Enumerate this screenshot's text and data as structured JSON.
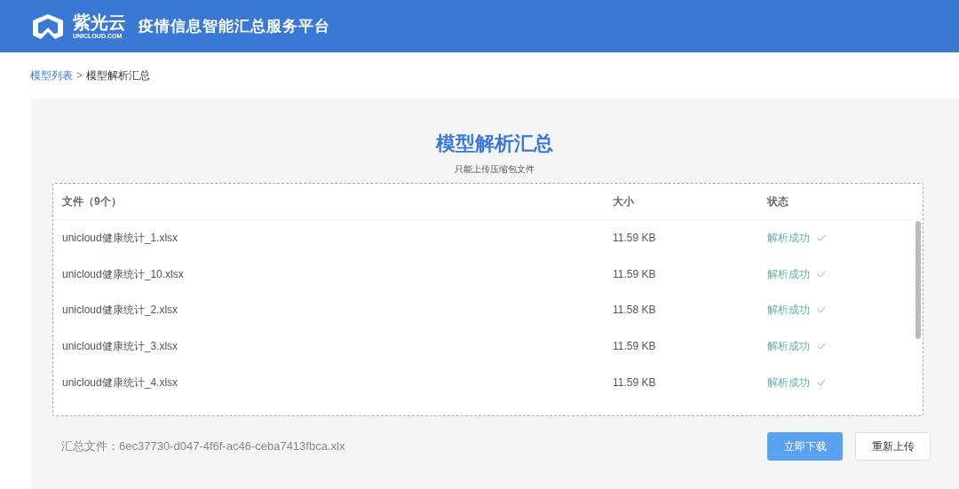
{
  "header": {
    "logo_text": "紫光云",
    "logo_subtext": "UNICLOUD.COM",
    "title": "疫情信息智能汇总服务平台"
  },
  "breadcrumb": [
    {
      "label": "模型列表",
      "link": true
    },
    {
      "label": "模型解析汇总",
      "link": false
    }
  ],
  "breadcrumb_separator": ">",
  "panel": {
    "title": "模型解析汇总",
    "subtitle": "只能上传压缩包文件"
  },
  "table": {
    "columns": [
      "文件（9个）",
      "大小",
      "状态"
    ],
    "rows": [
      {
        "file": "unicloud健康统计_1.xlsx",
        "size": "11.59 KB",
        "status": "解析成功",
        "success": true
      },
      {
        "file": "unicloud健康统计_10.xlsx",
        "size": "11.59 KB",
        "status": "解析成功",
        "success": true
      },
      {
        "file": "unicloud健康统计_2.xlsx",
        "size": "11.58 KB",
        "status": "解析成功",
        "success": true
      },
      {
        "file": "unicloud健康统计_3.xlsx",
        "size": "11.59 KB",
        "status": "解析成功",
        "success": true
      },
      {
        "file": "unicloud健康统计_4.xlsx",
        "size": "11.59 KB",
        "status": "解析成功",
        "success": true
      }
    ]
  },
  "footer": {
    "summary_label": "汇总文件：",
    "summary_file": "6ec37730-d047-4f6f-ac46-ceba7413fbca.xlx",
    "buttons": [
      {
        "label": "立即下载",
        "kind": "primary"
      },
      {
        "label": "重新上传",
        "kind": "default"
      }
    ]
  }
}
